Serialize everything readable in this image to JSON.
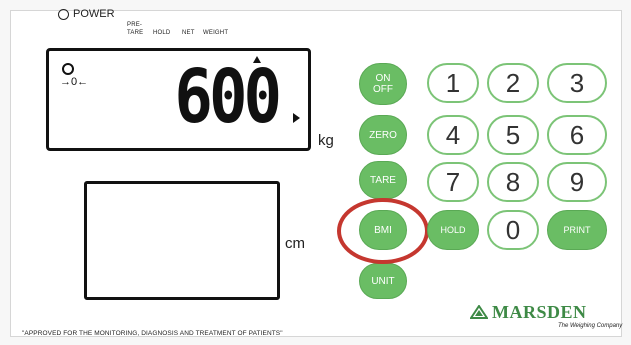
{
  "power_label": "POWER",
  "indicators": {
    "pre": "PRE-",
    "tare": "TARE",
    "hold": "HOLD",
    "net": "NET",
    "weight": "WEIGHT"
  },
  "display": {
    "value": "600",
    "zero_symbol": "→0←",
    "unit_kg": "kg",
    "unit_cm": "cm"
  },
  "keys": {
    "on_off_line1": "ON",
    "on_off_line2": "OFF",
    "zero": "ZERO",
    "tare": "TARE",
    "bmi": "BMI",
    "unit": "UNIT",
    "hold": "HOLD",
    "print": "PRINT",
    "n1": "1",
    "n2": "2",
    "n3": "3",
    "n4": "4",
    "n5": "5",
    "n6": "6",
    "n7": "7",
    "n8": "8",
    "n9": "9",
    "n0": "0"
  },
  "brand": {
    "name": "MARSDEN",
    "tagline": "The Weighing Company"
  },
  "footnote": "\"APPROVED FOR THE MONITORING, DIAGNOSIS AND TREATMENT OF PATIENTS\"",
  "colors": {
    "green": "#6abd64",
    "highlight": "#c5372f",
    "brand": "#3e8a46"
  }
}
